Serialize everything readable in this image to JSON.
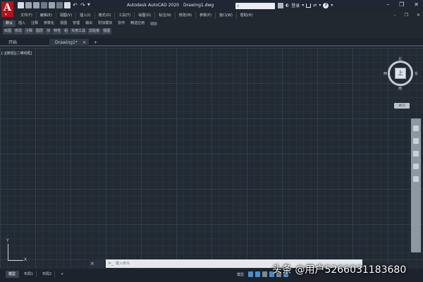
{
  "titlebar": {
    "app_title": "Autodesk AutoCAD 2020",
    "file_name": "Drawing1.dwg",
    "search_placeholder": "",
    "search_value": "",
    "user_label": "登录",
    "help_label": "?"
  },
  "menubar": {
    "items": [
      "文件(F)",
      "编辑(E)",
      "视图(V)",
      "插入(I)",
      "格式(O)",
      "工具(T)",
      "绘图(D)",
      "标注(N)",
      "修改(M)",
      "参数(P)",
      "窗口(W)",
      "帮助(H)"
    ]
  },
  "ribbon": {
    "tabs": [
      "默认",
      "插入",
      "注释",
      "参数化",
      "视图",
      "管理",
      "输出",
      "附加模块",
      "协作",
      "精选应用"
    ],
    "active_tab": "默认",
    "panels": [
      "绘图",
      "修改",
      "注释",
      "图层",
      "块",
      "特性",
      "组",
      "实用工具",
      "剪贴板",
      "视图"
    ]
  },
  "doc_tabs": {
    "start": "开始",
    "drawing": "Drawing1*",
    "close_glyph": "×",
    "add_glyph": "+"
  },
  "viewport": {
    "label": "[-][俯视][二维线框]"
  },
  "viewcube": {
    "top": "上",
    "north": "北",
    "south": "南",
    "west": "西",
    "east": "东",
    "wcs": "WCS"
  },
  "ucs": {
    "x": "X",
    "y": "Y"
  },
  "command": {
    "placeholder": "键入命令",
    "controls": "× ⌕"
  },
  "layout_tabs": [
    "模型",
    "布局1",
    "布局2",
    "+"
  ],
  "status": {
    "model": "模型"
  },
  "watermark": "头条 @用户5266031183680"
}
